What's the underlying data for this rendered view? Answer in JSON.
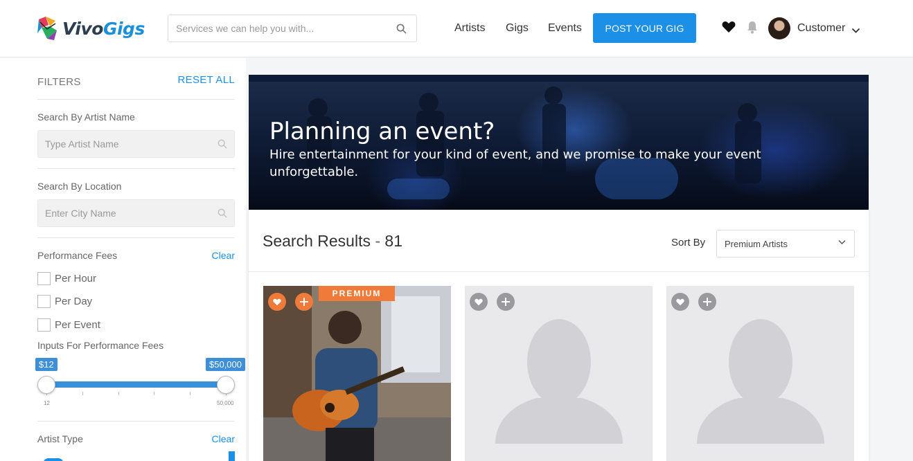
{
  "header": {
    "logo_text_a": "Vivo",
    "logo_text_b": "Gigs",
    "search_placeholder": "Services we can help you with...",
    "nav": [
      "Artists",
      "Gigs",
      "Events"
    ],
    "post_button": "POST YOUR GIG",
    "user_name": "Customer"
  },
  "sidebar": {
    "filters_title": "FILTERS",
    "reset_all": "RESET ALL",
    "artist_name_label": "Search By Artist Name",
    "artist_name_placeholder": "Type Artist Name",
    "location_label": "Search By Location",
    "location_placeholder": "Enter City Name",
    "fees_label": "Performance Fees",
    "clear": "Clear",
    "fee_options": [
      "Per Hour",
      "Per Day",
      "Per Event"
    ],
    "inputs_label": "Inputs For Performance Fees",
    "range_min_tip": "$12",
    "range_max_tip": "$50,000",
    "range_min_tick": "12",
    "range_max_tick": "50,000",
    "artist_type_label": "Artist Type",
    "artist_type_clear": "Clear"
  },
  "banner": {
    "title": "Planning an event?",
    "subtitle": "Hire entertainment for your kind of event, and we promise to make your event unforgettable."
  },
  "results": {
    "title": "Search Results",
    "separator": "-",
    "count": "81",
    "sort_label": "Sort By",
    "sort_value": "Premium Artists",
    "premium_badge": "PREMIUM"
  },
  "colors": {
    "accent": "#1b90e6",
    "premium": "#f07a3a"
  }
}
